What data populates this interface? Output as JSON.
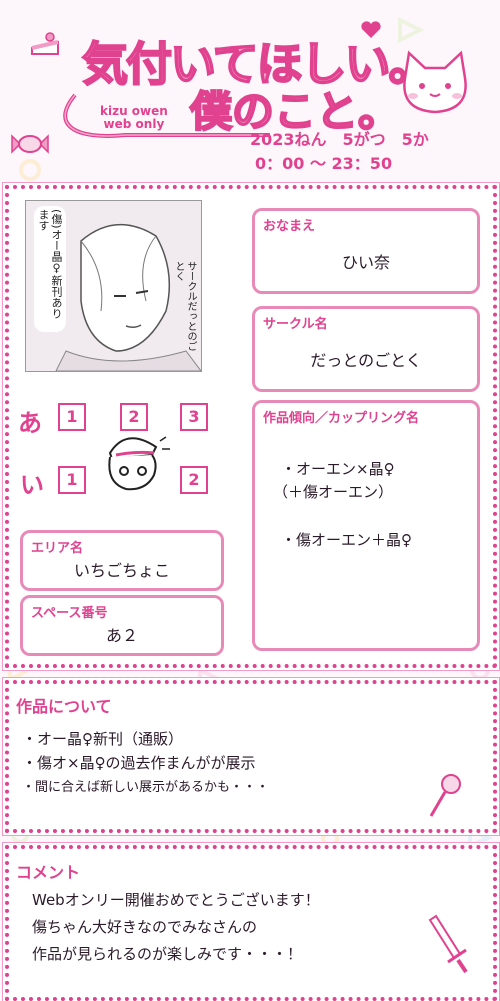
{
  "header": {
    "logo_line1": "気付いてほしい。",
    "logo_line2": "僕のこと。",
    "logo_sub1": "kizu owen",
    "logo_sub2": "web only",
    "date": "2023ねん　5がつ　5か",
    "time": "0：00 ～ 23：50"
  },
  "manga": {
    "bubble_left": "(傷)オー晶♀新刊あります",
    "bubble_right": "サークルだっとのごとく"
  },
  "fields": {
    "name_label": "おなまえ",
    "name_value": "ひい奈",
    "circle_label": "サークル名",
    "circle_value": "だっとのごとく",
    "genre_label": "作品傾向／カップリング名",
    "genre_line1": "・オーエン×晶♀",
    "genre_line2": "（＋傷オーエン）",
    "genre_line3": "・傷オーエン＋晶♀",
    "area_label": "エリア名",
    "area_value": "いちごちょこ",
    "space_label": "スペース番号",
    "space_value": "あ２"
  },
  "seats": {
    "row_a": "あ",
    "row_i": "い",
    "a1": "1",
    "a2": "2",
    "a3": "3",
    "i1": "1",
    "i2": "2"
  },
  "about": {
    "title": "作品について",
    "line1": "・オー晶♀新刊（通販）",
    "line2": "・傷オ×晶♀の過去作まんがが展示",
    "line3": "・間に合えば新しい展示があるかも・・・"
  },
  "comment": {
    "title": "コメント",
    "line1": "Webオンリー開催おめでとうございます！",
    "line2": "傷ちゃん大好きなのでみなさんの",
    "line3": "作品が見られるのが楽しみです・・・！"
  },
  "colors": {
    "accent": "#e0428f",
    "light": "#f29bc6",
    "background": "#fdf7fb"
  }
}
